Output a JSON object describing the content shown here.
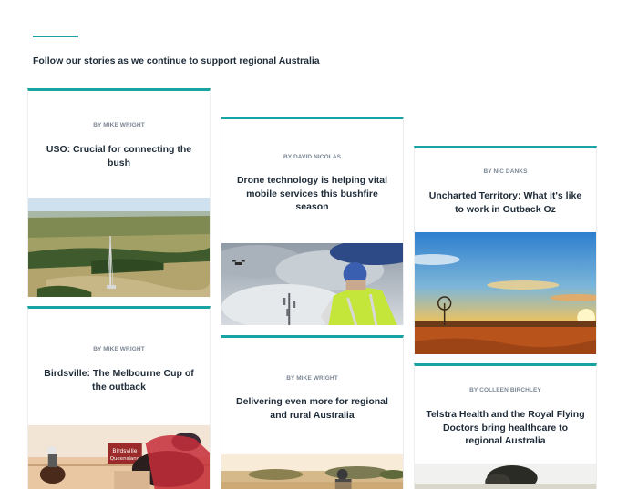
{
  "intro": "Follow our stories as we continue to support regional Australia",
  "cards": [
    {
      "byline": "BY MIKE WRIGHT",
      "title": "USO: Crucial for connecting the bush"
    },
    {
      "byline": "BY DAVID NICOLAS",
      "title": "Drone technology is helping vital mobile services this bushfire season"
    },
    {
      "byline": "BY NIC DANKS",
      "title": "Uncharted Territory: What it's like to work in Outback Oz"
    },
    {
      "byline": "BY MIKE WRIGHT",
      "title": "Birdsville: The Melbourne Cup of the outback"
    },
    {
      "byline": "BY MIKE WRIGHT",
      "title": "Delivering even more for regional and rural Australia"
    },
    {
      "byline": "BY COLLEEN BIRCHLEY",
      "title": "Telstra Health and the Royal Flying Doctors bring healthcare to regional Australia"
    }
  ],
  "signs": {
    "line1": "Birdsville",
    "line2": "Queensland"
  },
  "colors": {
    "accent": "#1aa3a3"
  }
}
